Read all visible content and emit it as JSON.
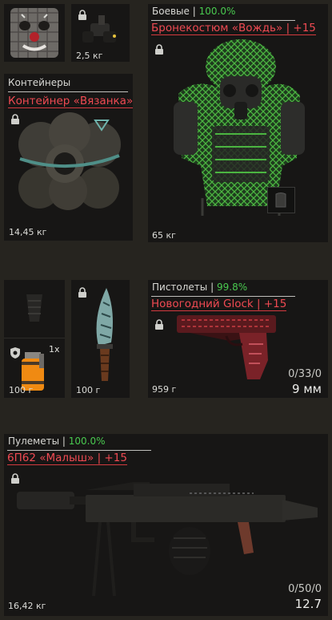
{
  "slots": {
    "face": {
      "name": "face-mask",
      "locked": true
    },
    "nvg": {
      "weight": "2,5 кг",
      "locked": true
    },
    "armor": {
      "category": "Боевые",
      "separator": "|",
      "durability": "100.0%",
      "title": "Бронекостюм «Вождь»",
      "upgrade": "| +15",
      "weight": "65 кг",
      "locked": true
    },
    "container": {
      "category": "Контейнеры",
      "title": "Контейнер «Вязанка»",
      "weight": "14,45 кг",
      "locked": true
    },
    "belt": {
      "count": "1x",
      "weight": "100 г"
    },
    "knife": {
      "weight": "100 г",
      "locked": true
    },
    "pistol": {
      "category": "Пистолеты",
      "separator": "|",
      "durability": "99.8%",
      "title": "Новогодний Glock",
      "upgrade": "| +15",
      "weight": "959 г",
      "ammo": "0/33/0",
      "caliber": "9 мм",
      "locked": true
    },
    "mg": {
      "category": "Пулеметы",
      "separator": "|",
      "durability": "100.0%",
      "title": "6П62 «Малыш»",
      "upgrade": "| +15",
      "weight": "16,42 кг",
      "ammo": "0/50/0",
      "caliber": "12.7",
      "locked": true
    }
  },
  "colors": {
    "background": "#26241f",
    "slot": "#171615",
    "durability": "#49c94f",
    "item_name": "#ef4a52",
    "armor_green": "#3fa03a"
  }
}
